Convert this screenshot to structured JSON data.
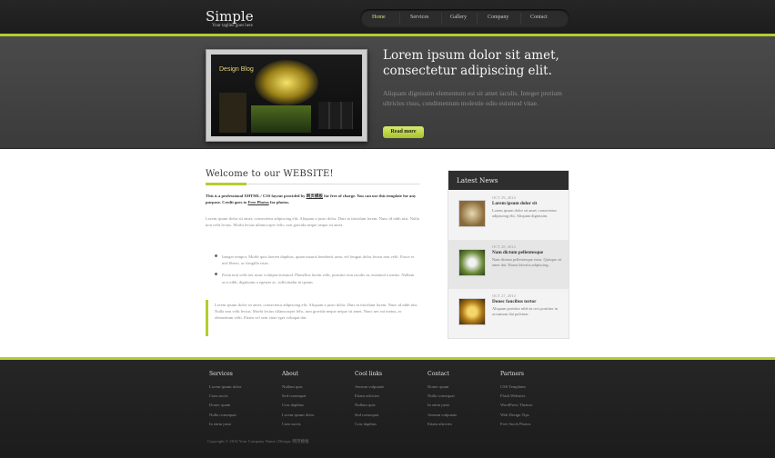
{
  "header": {
    "logo": "Simple",
    "tagline": "Your tagline goes here",
    "nav": [
      "Home",
      "Services",
      "Gallery",
      "Company",
      "Contact"
    ],
    "active_nav": "Home"
  },
  "hero": {
    "heading": "Lorem ipsum dolor sit amet, consectetur adipiscing elit.",
    "text": "Aliquam dignissim elementum est sit amet iaculis. Integer pretium ultricies risus, condimentum molestie odio euismod vitae.",
    "button": "Read more",
    "screenshot_title": "Design Blog"
  },
  "main": {
    "welcome_title": "Welcome to our WEBSITE!",
    "intro_pre": "This is a professional XHTML / CSS layout provided by ",
    "intro_link1": "网页模板",
    "intro_mid": " for free of charge. You can use this template for any purpose. Credit goes to ",
    "intro_link2": "Free Photos",
    "intro_post": " for photos.",
    "para1": "Lorem ipsum dolor sit amet, consectetur adipiscing elit. Aliquam a justo dolor. Duis in tincidunt lorem. Nunc id nibh nisi. Nulla non velit lectus. Morbi lectus ullamcorper felis, non gravida neque neque sit amet.",
    "bullets": [
      "Integer tempor. Morbi quis laoreet dapibus, quam mauris hendrerit urna, vel feugiat dolor lectus non velit. Fusce et nisl libero, ac fringilla risus.",
      "Proin non velit nec nunc volutpat euismod. Phasellus lorem velit, porttitor non iaculis in, euismod a metus. Nullam orci nibh, dignissim a egestas ac, sollicitudin in ipsum."
    ],
    "quote": "Lorem ipsum dolor sit amet, consectetur adipiscing elit. Aliquam a justo dolor. Duis in tincidunt lorem. Nunc id nibh nisi. Nulla non velit lectus. Morbi lectus ullamcorper felis, non gravida neque neque sit amet. Nunc nec mi metus, ac elementum velit. Etiam vel sem vitae eget volutpat dui."
  },
  "news": {
    "title": "Latest News",
    "items": [
      {
        "date": "OCT 29, 2014",
        "headline": "Lorem ipsum dolor sit",
        "text": "Lorem ipsum dolor sit amet, consectetur adipiscing elit. Aliquam dignissim."
      },
      {
        "date": "OCT 28, 2014",
        "headline": "Nam dictum pellentesque",
        "text": "Nam dictum pellentesque risus. Quisque sit amet dui. Etiam lobortis adipiscing."
      },
      {
        "date": "OCT 27, 2014",
        "headline": "Donec faucibus tortor",
        "text": "Aliquam porttitor nibh in orci porttitor in accumsan dui pulvinar."
      }
    ]
  },
  "footer": {
    "columns": [
      {
        "title": "Services",
        "links": [
          "Lorem ipsum dolor",
          "Cum sociis",
          "Donec quam",
          "Nulla consequat",
          "In enim justo"
        ]
      },
      {
        "title": "About",
        "links": [
          "Nullam quis",
          "Sed consequat",
          "Cras dapibus",
          "Lorem ipsum dolor",
          "Cum sociis"
        ]
      },
      {
        "title": "Cool links",
        "links": [
          "Aenean vulputate",
          "Etiam ultricies",
          "Nullam quis",
          "Sed consequat",
          "Cras dapibus"
        ]
      },
      {
        "title": "Contact",
        "links": [
          "Donec quam",
          "Nulla consequat",
          "In enim justo",
          "Aenean vulputate",
          "Etiam ultricies"
        ]
      },
      {
        "title": "Partners",
        "links": [
          "CSS Templates",
          "Flash Websites",
          "WordPress Themes",
          "Web Design Tips",
          "Free Stock Photos"
        ]
      }
    ],
    "copyright": "Copyright © 2014 Your Company Name | Design: 网页模板"
  },
  "colors": {
    "accent": "#b6cc2e",
    "dark": "#222222",
    "hero": "#444444"
  }
}
